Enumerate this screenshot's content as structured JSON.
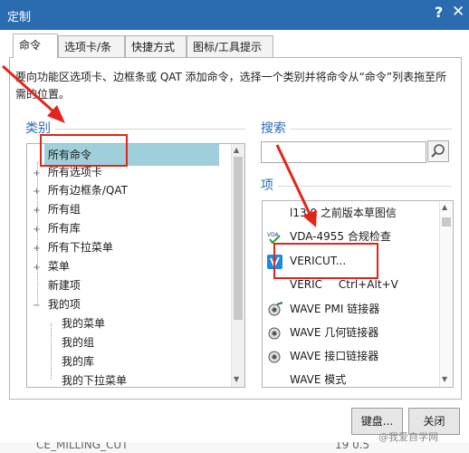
{
  "window": {
    "title": "定制",
    "help": "?",
    "close": "✕"
  },
  "tabs": [
    {
      "label": "命令",
      "active": true
    },
    {
      "label": "选项卡/条"
    },
    {
      "label": "快捷方式"
    },
    {
      "label": "图标/工具提示"
    }
  ],
  "description": "要向功能区选项卡、边框条或 QAT 添加命令，选择一个类别并将命令从“命令”列表拖至所需的位置。",
  "category": {
    "label": "类别",
    "items": [
      {
        "label": "所有命令",
        "expander": "",
        "selected": true
      },
      {
        "label": "所有选项卡",
        "expander": "+"
      },
      {
        "label": "所有边框条/QAT",
        "expander": "+"
      },
      {
        "label": "所有组",
        "expander": "+"
      },
      {
        "label": "所有库",
        "expander": "+"
      },
      {
        "label": "所有下拉菜单",
        "expander": "+"
      },
      {
        "label": "菜单",
        "expander": "+"
      },
      {
        "label": "新建项",
        "expander": ""
      },
      {
        "label": "我的项",
        "expander": "−"
      },
      {
        "label": "我的菜单",
        "expander": ""
      },
      {
        "label": "我的组",
        "expander": ""
      },
      {
        "label": "我的库",
        "expander": ""
      },
      {
        "label": "我的下拉菜单",
        "expander": ""
      }
    ]
  },
  "search": {
    "label": "搜索",
    "value": "",
    "placeholder": ""
  },
  "items_panel": {
    "label": "项",
    "items": [
      {
        "label": "l13.0 之前版本草图信",
        "icon": "blank-icon"
      },
      {
        "label": "VDA-4955 合规检查",
        "icon": "vda-icon"
      },
      {
        "label": "VERICUT...",
        "icon": "vericut-icon"
      },
      {
        "label": "VERIC",
        "shortcut": "Ctrl+Alt+V",
        "icon": "blank-icon"
      },
      {
        "label": "WAVE PMI 链接器",
        "icon": "wave-link-icon"
      },
      {
        "label": "WAVE 几何链接器",
        "icon": "wave-link-icon"
      },
      {
        "label": "WAVE 接口链接器",
        "icon": "wave-link-icon"
      },
      {
        "label": "WAVE 模式",
        "icon": "blank-icon"
      }
    ]
  },
  "buttons": {
    "keyboard": "键盘...",
    "close": "关闭"
  },
  "watermark": "@我爱自学网",
  "bottom_fragment": {
    "left": "CE_MILLING_CUT",
    "right": "19 0.5"
  },
  "colors": {
    "titlebar": "#2b6cb0",
    "selection": "#9fcfdb",
    "annotation_red": "#e1251b",
    "label_blue": "#2b6cb0"
  }
}
